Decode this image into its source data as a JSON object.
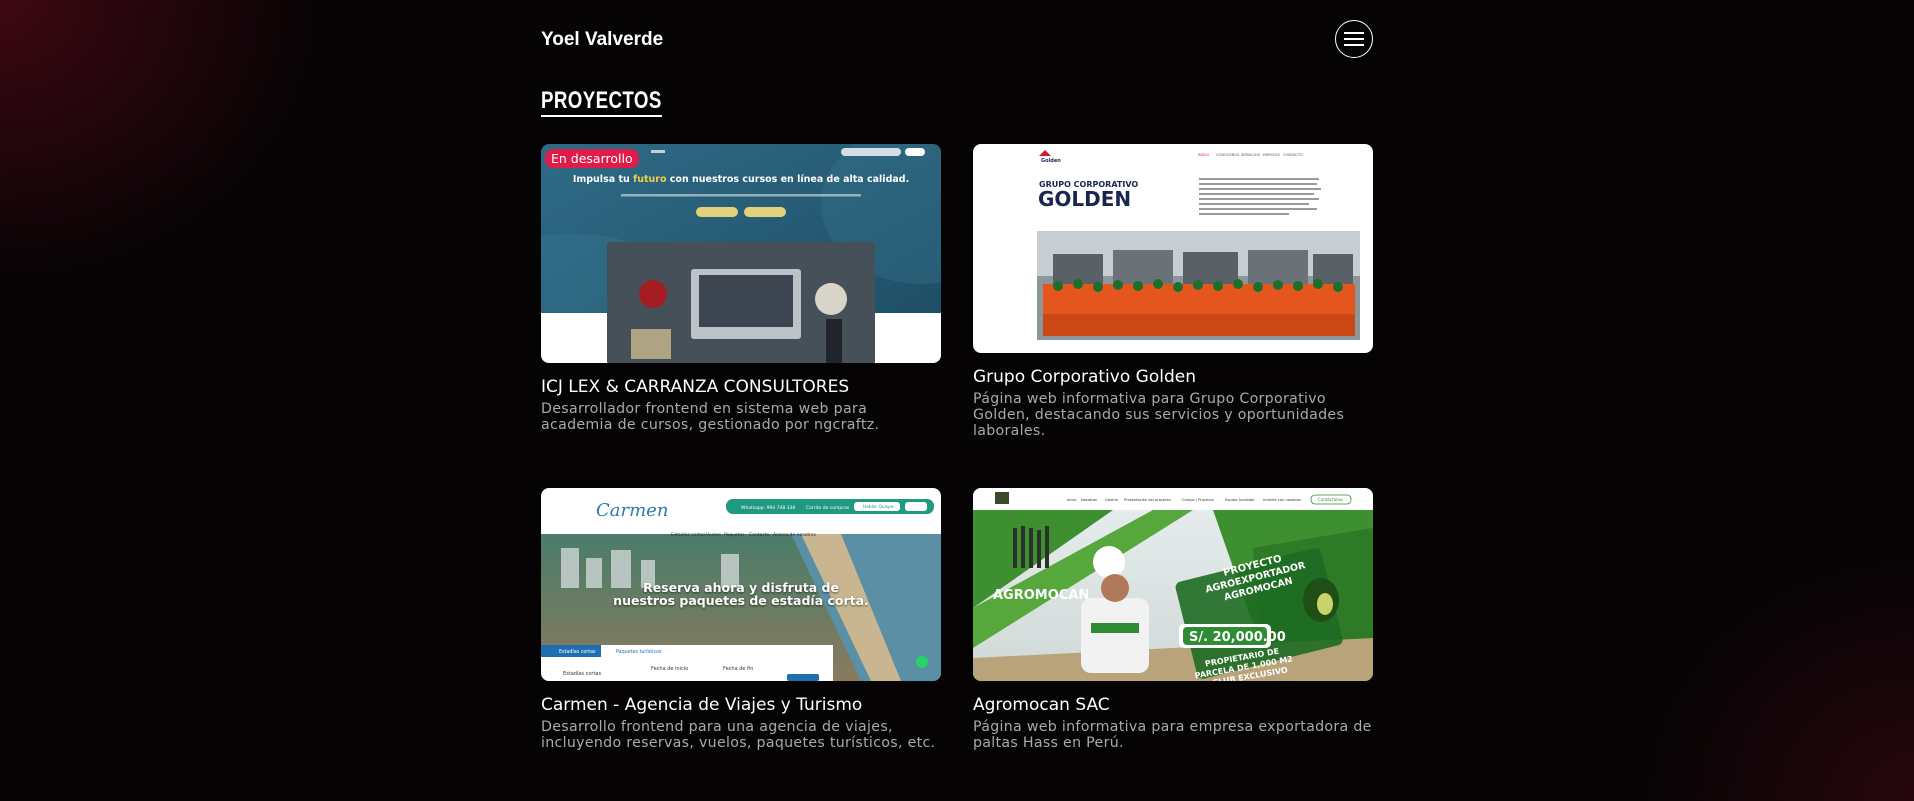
{
  "header": {
    "brand": "Yoel Valverde",
    "menu_icon": "hamburger-menu-icon"
  },
  "section": {
    "title": "PROYECTOS"
  },
  "projects": [
    {
      "badge": "En desarrollo",
      "title": "ICJ LEX & CARRANZA CONSULTORES",
      "description": "Desarrollador frontend en sistema web para academia de cursos, gestionado por ngcraftz.",
      "preview": {
        "headline_a": "Impulsa tu ",
        "headline_highlight": "futuro",
        "headline_b": " con nuestros cursos en línea de alta calidad."
      }
    },
    {
      "title": "Grupo Corporativo Golden",
      "description": "Página web informativa para Grupo Corporativo Golden, destacando sus servicios y oportunidades laborales.",
      "preview": {
        "logo": "Golden",
        "small_title": "GRUPO CORPORATIVO",
        "big_title": "GOLDEN",
        "nav": [
          "INICIO",
          "CONÓCENOS",
          "SERVICIOS",
          "EMPLEOS",
          "CONTACTO"
        ]
      }
    },
    {
      "title": "Carmen - Agencia de Viajes y Turismo",
      "description": "Desarrollo frontend para una agencia de viajes, incluyendo reservas, vuelos, paquetes turísticos, etc.",
      "preview": {
        "logo": "Carmen",
        "headline": "Reserva ahora y disfruta de nuestros paquetes de estadía corta.",
        "whatsapp": "Whatsapp: 994 748 338",
        "cart": "Carrito de compras",
        "help": "Hablar Quispe",
        "nav": [
          "Estadías cortas",
          "Vuelos",
          "Paquetes",
          "Contacto",
          "Acerca de nosotros"
        ],
        "tabs": [
          "Estadías cortas",
          "Paquetes turísticos"
        ],
        "fields": [
          "Estadías cortas",
          "Fecha de inicio",
          "Fecha de fin"
        ]
      }
    },
    {
      "title": "Agromocan SAC",
      "description": "Página web informativa para empresa exportadora de paltas Hass en Perú.",
      "preview": {
        "brand": "AGROMOCAN",
        "line1": "PROYECTO",
        "line2": "AGROEXPORTADOR",
        "line3": "AGROMOCAN",
        "price": "S/. 20,000.00",
        "sub1": "PROPIETARIO DE",
        "sub2": "PARCELA DE 1,000 M2",
        "sub3": "+ CLUB EXCLUSIVO",
        "contact": "Contáctanos",
        "nav": [
          "Inicio",
          "Nosotros",
          "Galería",
          "Presentación del proyecto",
          "Campo / Proyecto",
          "Equipo fundador",
          "Invierte con nosotros"
        ]
      }
    }
  ]
}
